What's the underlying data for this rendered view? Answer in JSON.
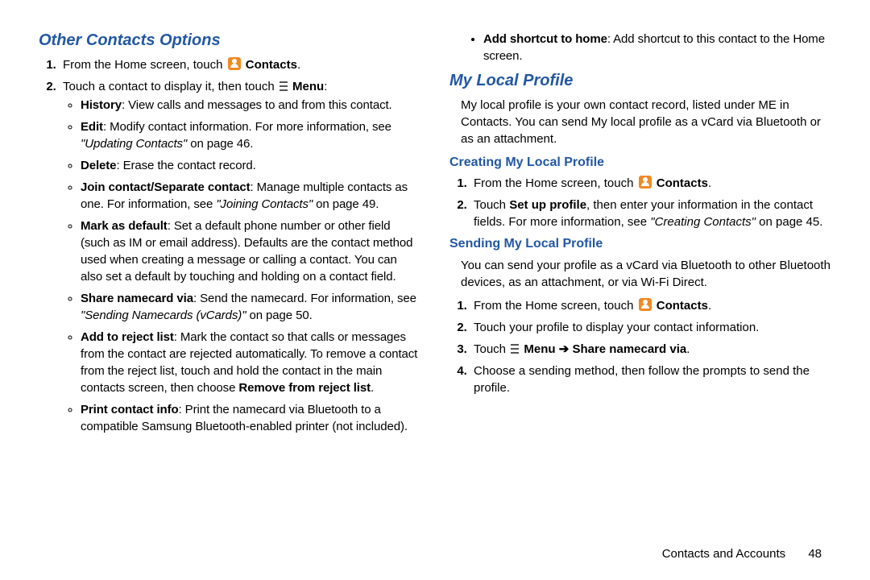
{
  "left": {
    "heading": "Other Contacts Options",
    "step1_a": "From the Home screen, touch ",
    "step1_b": "Contacts",
    "step1_c": ".",
    "step2_a": "Touch a contact to display it, then touch ",
    "step2_b": "Menu",
    "step2_c": ":",
    "b_history_t": "History",
    "b_history": ": View calls and messages to and from this contact.",
    "b_edit_t": "Edit",
    "b_edit": ": Modify contact information. For more information, see ",
    "b_edit_ref": "\"Updating Contacts\"",
    "b_edit_pg": " on page 46.",
    "b_delete_t": "Delete",
    "b_delete": ": Erase the contact record.",
    "b_join_t": "Join contact/Separate contact",
    "b_join": ": Manage multiple contacts as one. For information, see ",
    "b_join_ref": "\"Joining Contacts\"",
    "b_join_pg": " on page 49.",
    "b_mark_t": "Mark as default",
    "b_mark": ": Set a default phone number or other field (such as IM or email address). Defaults are the contact method used when creating a message or calling a contact. You can also set a default by touching and holding on a contact field.",
    "b_share_t": "Share namecard via",
    "b_share": ": Send the namecard. For information, see ",
    "b_share_ref": "\"Sending Namecards (vCards)\"",
    "b_share_pg": " on page 50.",
    "b_reject_t": "Add to reject list",
    "b_reject_a": ": Mark the contact so that calls or messages from the contact are rejected automatically. To remove a contact from the reject list, touch and hold the contact in the main contacts screen, then choose ",
    "b_reject_b": "Remove from reject list",
    "b_reject_c": ".",
    "b_print_t": "Print contact info",
    "b_print": ": Print the namecard via Bluetooth to a compatible Samsung Bluetooth-enabled printer (not included)."
  },
  "right": {
    "b_shortcut_t": "Add shortcut to home",
    "b_shortcut": ": Add shortcut to this contact to the Home screen.",
    "heading2": "My Local Profile",
    "intro": "My local profile is your own contact record, listed under ME in Contacts. You can send My local profile as a vCard via Bluetooth or as an attachment.",
    "h_create": "Creating My Local Profile",
    "c1_a": "From the Home screen, touch ",
    "c1_b": "Contacts",
    "c1_c": ".",
    "c2_a": "Touch ",
    "c2_b": "Set up profile",
    "c2_c": ", then enter your information in the contact fields. For more information, see ",
    "c2_ref": "\"Creating Contacts\"",
    "c2_pg": " on page 45.",
    "h_send": "Sending My Local Profile",
    "send_intro": "You can send your profile as a vCard via Bluetooth to other Bluetooth devices, as an attachment, or via Wi-Fi Direct.",
    "s1_a": "From the Home screen, touch ",
    "s1_b": "Contacts",
    "s1_c": ".",
    "s2": "Touch your profile to display your contact information.",
    "s3_a": "Touch ",
    "s3_b": "Menu",
    "s3_arrow": " ➔ ",
    "s3_c": "Share namecard via",
    "s3_d": ".",
    "s4": "Choose a sending method, then follow the prompts to send the profile."
  },
  "footer": {
    "section": "Contacts and Accounts",
    "page": "48"
  }
}
